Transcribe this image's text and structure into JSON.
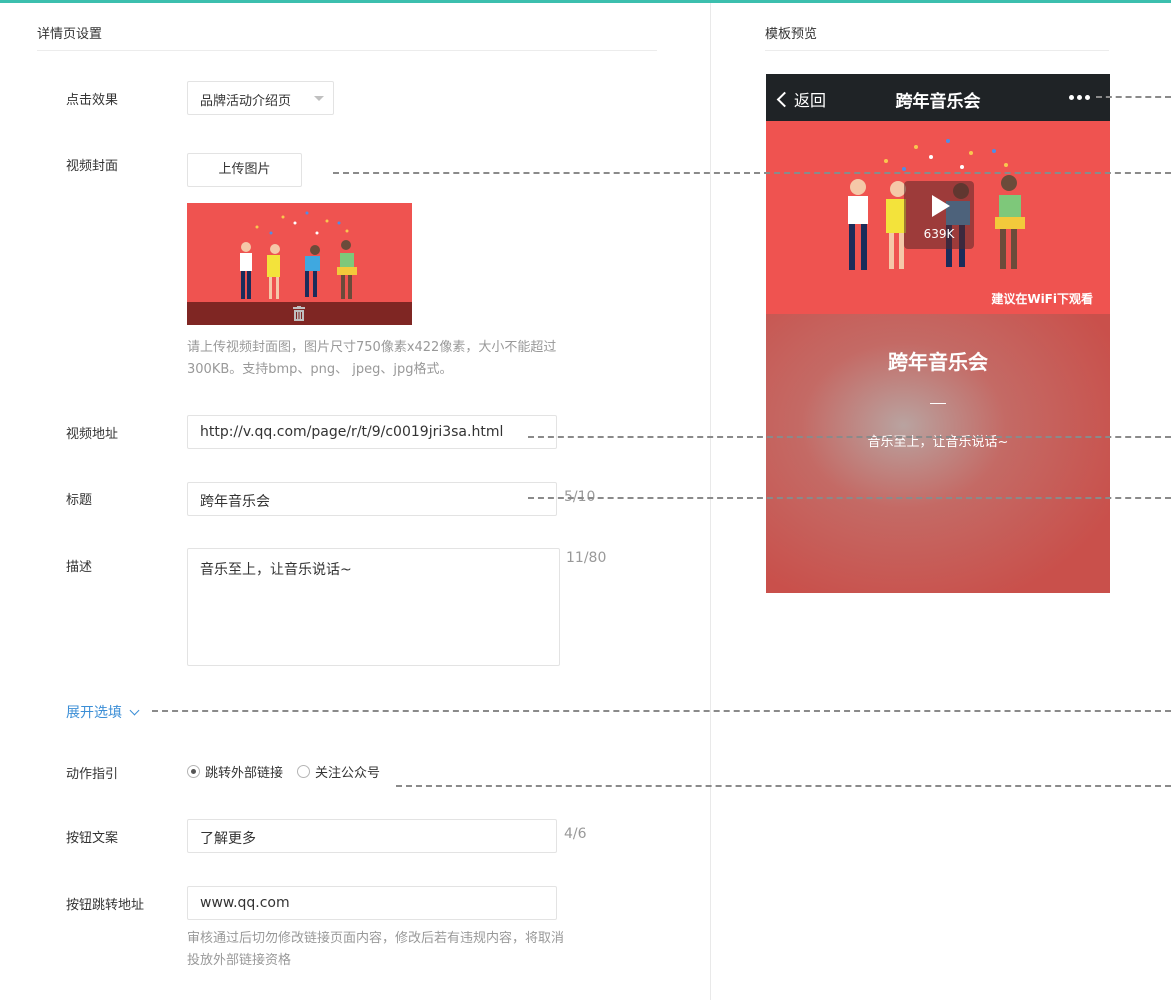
{
  "left_panel": {
    "title": "详情页设置",
    "click_effect": {
      "label": "点击效果",
      "selected": "品牌活动介绍页"
    },
    "video_cover": {
      "label": "视频封面",
      "upload_button": "上传图片",
      "hint_line1": "请上传视频封面图，图片尺寸750像素x422像素，大小不能超过",
      "hint_line2": "300KB。支持bmp、png、 jpeg、jpg格式。"
    },
    "video_url": {
      "label": "视频地址",
      "value": "http://v.qq.com/page/r/t/9/c0019jri3sa.html"
    },
    "title_field": {
      "label": "标题",
      "value": "跨年音乐会",
      "counter": "5/10"
    },
    "description": {
      "label": "描述",
      "value": "音乐至上，让音乐说话~",
      "counter": "11/80"
    },
    "expand_link": "展开选填",
    "action_guide": {
      "label": "动作指引",
      "options": [
        {
          "text": "跳转外部链接",
          "checked": true
        },
        {
          "text": "关注公众号",
          "checked": false
        }
      ]
    },
    "button_text": {
      "label": "按钮文案",
      "value": "了解更多",
      "counter": "4/6"
    },
    "button_url": {
      "label": "按钮跳转地址",
      "value": "www.qq.com",
      "hint_line1": "审核通过后切勿修改链接页面内容，修改后若有违规内容，将取消",
      "hint_line2": "投放外部链接资格"
    }
  },
  "right_panel": {
    "title": "模板预览",
    "phone": {
      "back_label": "返回",
      "nav_title": "跨年音乐会",
      "video_size": "639K",
      "wifi_tip": "建议在WiFi下观看",
      "content_title": "跨年音乐会",
      "content_desc": "音乐至上，让音乐说话~"
    }
  },
  "colors": {
    "accent_bar": "#3cbfae",
    "link": "#3b8ed6",
    "cover_red": "#ef5350",
    "nav_dark": "#1f2326"
  }
}
